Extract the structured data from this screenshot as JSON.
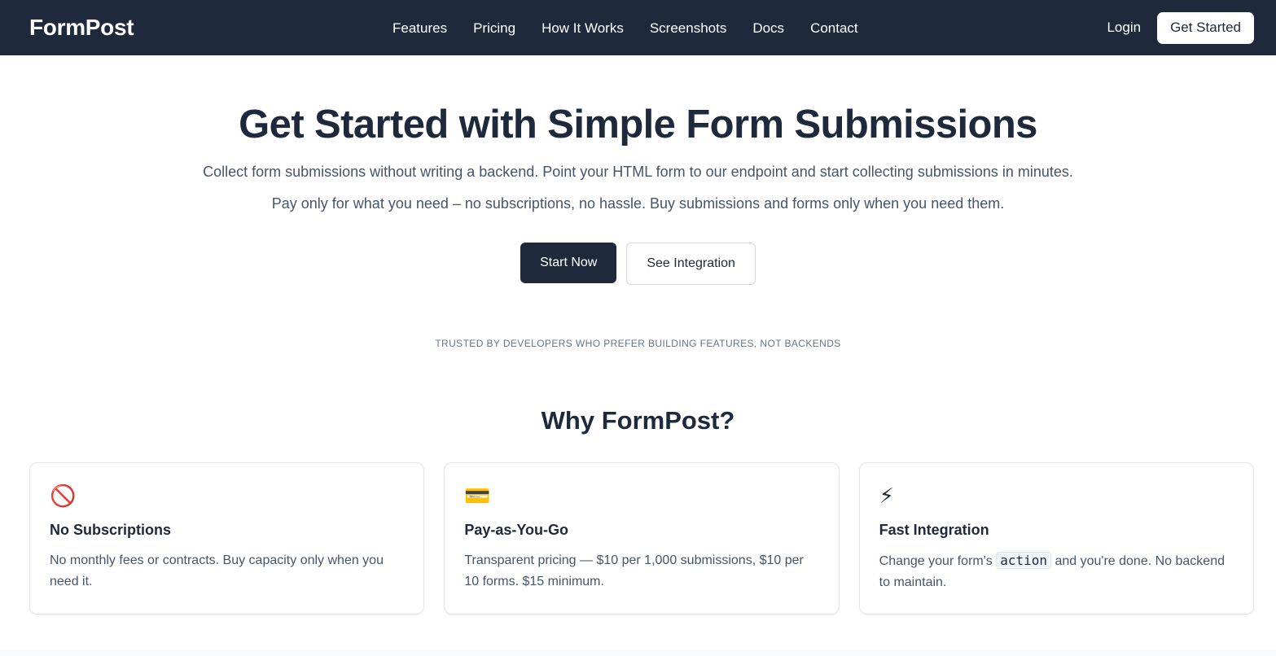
{
  "nav": {
    "brand": "FormPost",
    "links": [
      "Features",
      "Pricing",
      "How It Works",
      "Screenshots",
      "Docs",
      "Contact"
    ],
    "login_label": "Login",
    "get_started_label": "Get Started"
  },
  "hero": {
    "title": "Get Started with Simple Form Submissions",
    "subtitle_1": "Collect form submissions without writing a backend. Point your HTML form to our endpoint and start collecting submissions in minutes.",
    "subtitle_2": "Pay only for what you need – no subscriptions, no hassle. Buy submissions and forms only when you need them.",
    "primary_cta": "Start Now",
    "secondary_cta": "See Integration",
    "trusted_text": "TRUSTED BY DEVELOPERS WHO PREFER BUILDING FEATURES, NOT BACKENDS"
  },
  "why": {
    "heading": "Why FormPost?",
    "cards": [
      {
        "icon": "no-entry-icon",
        "glyph": "🚫",
        "title": "No Subscriptions",
        "text": "No monthly fees or contracts. Buy capacity only when you need it."
      },
      {
        "icon": "credit-card-icon",
        "glyph": "💳",
        "title": "Pay-as-You-Go",
        "text": "Transparent pricing — $10 per 1,000 submissions, $10 per 10 forms. $15 minimum."
      },
      {
        "icon": "lightning-icon",
        "glyph": "⚡",
        "title": "Fast Integration",
        "text_before": "Change your form's ",
        "code": "action",
        "text_after": " and you're done. No backend to maintain."
      }
    ]
  },
  "colors": {
    "nav_bg": "#1e293b",
    "primary": "#1e293b",
    "text_muted": "#475569"
  }
}
